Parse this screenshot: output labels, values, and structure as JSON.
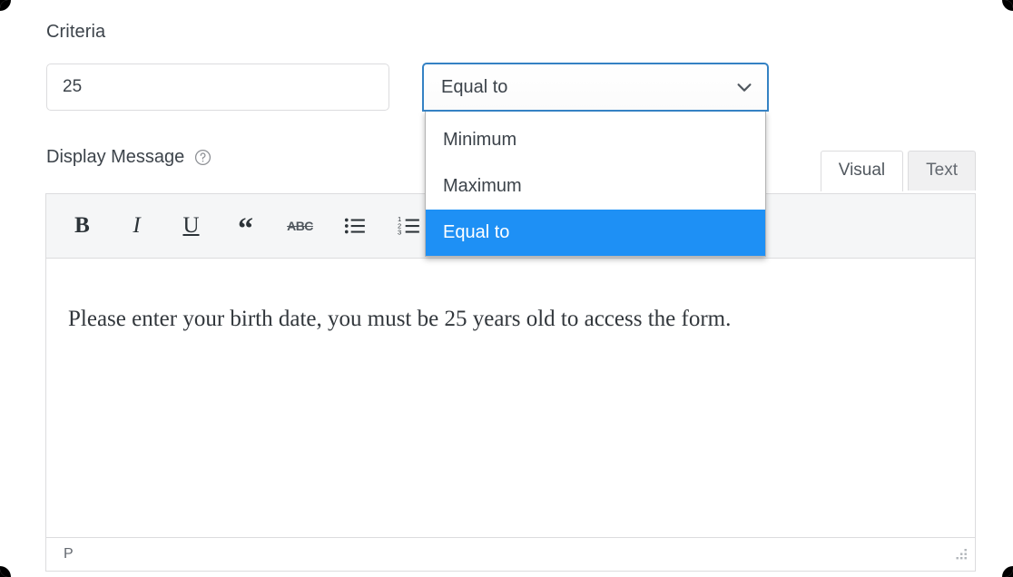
{
  "criteria": {
    "label": "Criteria",
    "value": "25",
    "placeholder": "",
    "select": {
      "value": "Equal to",
      "chevron_icon": "chevron-down-icon",
      "options": [
        "Minimum",
        "Maximum",
        "Equal to"
      ],
      "selected_index": 2,
      "focus_color": "#3582c4",
      "highlight_color": "#1e90f5"
    }
  },
  "display_message": {
    "label": "Display Message",
    "help_icon": "help-circle-icon",
    "tabs": [
      {
        "label": "Visual",
        "active": true
      },
      {
        "label": "Text",
        "active": false
      }
    ],
    "toolbar": [
      {
        "name": "bold",
        "glyph": "B"
      },
      {
        "name": "italic",
        "glyph": "I"
      },
      {
        "name": "underline",
        "glyph": "U"
      },
      {
        "name": "blockquote",
        "glyph": "“"
      },
      {
        "name": "strikethrough",
        "glyph": "ABC"
      },
      {
        "name": "unordered-list",
        "glyph": ""
      },
      {
        "name": "ordered-list",
        "glyph": ""
      }
    ],
    "content": "Please enter your birth date, you must be 25 years old to access the form.",
    "status_path": "P",
    "resize_icon": "resize-grip-icon"
  }
}
